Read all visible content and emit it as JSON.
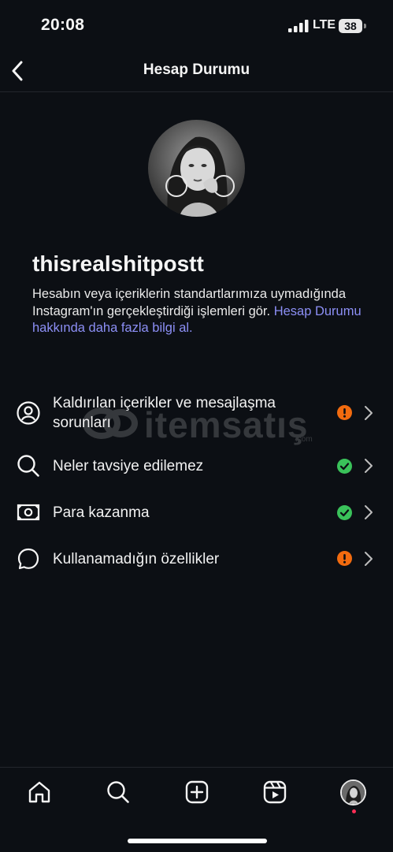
{
  "status_bar": {
    "time": "20:08",
    "network": "LTE",
    "battery": "38"
  },
  "header": {
    "title": "Hesap Durumu"
  },
  "profile": {
    "username": "thisrealshitpostt",
    "description": "Hesabın veya içeriklerin standartlarımıza uymadığında Instagram'ın gerçekleştirdiği işlemleri gör. ",
    "link_text": "Hesap Durumu hakkında daha fazla bilgi al."
  },
  "items": [
    {
      "label": "Kaldırılan içerikler ve mesajlaşma sorunları",
      "icon": "user-circle-icon",
      "status": "warning"
    },
    {
      "label": "Neler tavsiye edilemez",
      "icon": "search-icon",
      "status": "ok"
    },
    {
      "label": "Para kazanma",
      "icon": "money-icon",
      "status": "ok"
    },
    {
      "label": "Kullanamadığın özellikler",
      "icon": "chat-bubble-icon",
      "status": "warning"
    }
  ],
  "watermark": {
    "text": "itemsatış",
    "domain": ".com"
  },
  "colors": {
    "background": "#0c0f14",
    "link": "#8c8ff5",
    "warning": "#f26b0f",
    "ok": "#3ac25a"
  },
  "tabs": [
    "home-icon",
    "search-icon",
    "create-icon",
    "reels-icon",
    "profile-avatar"
  ]
}
